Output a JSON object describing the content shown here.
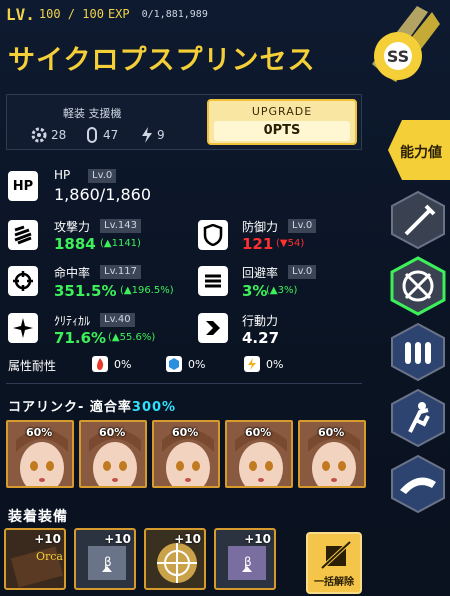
{
  "header": {
    "lv_label": "LV.",
    "lv_value": "100 / 100",
    "exp_label": "EXP",
    "exp_value": "0/1,881,989"
  },
  "character": {
    "name": "サイクロプスプリンセス",
    "class_line": "軽装 支援機",
    "gear_count": "28",
    "cap_count": "47",
    "bolt_count": "9"
  },
  "upgrade": {
    "label": "UPGRADE",
    "value": "0PTS"
  },
  "stats": {
    "hp": {
      "badge": "HP",
      "label": "HP",
      "lv": "Lv.0",
      "value": "1,860/1,860"
    },
    "attack": {
      "label": "攻撃力",
      "lv": "Lv.143",
      "value": "1884",
      "delta": "(▲1141)"
    },
    "defense": {
      "label": "防御力",
      "lv": "Lv.0",
      "value": "121",
      "delta": "(▼54)"
    },
    "accuracy": {
      "label": "命中率",
      "lv": "Lv.117",
      "value": "351.5%",
      "delta": "(▲196.5%)"
    },
    "evasion": {
      "label": "回避率",
      "lv": "Lv.0",
      "value": "3%",
      "delta": "(▲3%)"
    },
    "critical": {
      "label": "ｸﾘﾃｨｶﾙ",
      "lv": "Lv.40",
      "value": "71.6%",
      "delta": "(▲55.6%)"
    },
    "action": {
      "label": "行動力",
      "value": "4.27"
    }
  },
  "resist": {
    "label": "属性耐性",
    "fire": "0%",
    "ice": "0%",
    "electric": "0%"
  },
  "corelink": {
    "label": "コアリンク- 適合率",
    "percent": "300%",
    "cards": [
      "60%",
      "60%",
      "60%",
      "60%",
      "60%"
    ]
  },
  "equipment": {
    "label": "装着装備",
    "items": [
      "+10",
      "+10",
      "+10",
      "+10"
    ],
    "unequip_all": "一括解除",
    "orca_text": "Orca"
  },
  "side_tab": {
    "label": "能力値"
  },
  "colors": {
    "accent_yellow": "#f4cf37",
    "green": "#3cf05a",
    "red": "#ff3030",
    "cyan": "#2fe0ff"
  }
}
